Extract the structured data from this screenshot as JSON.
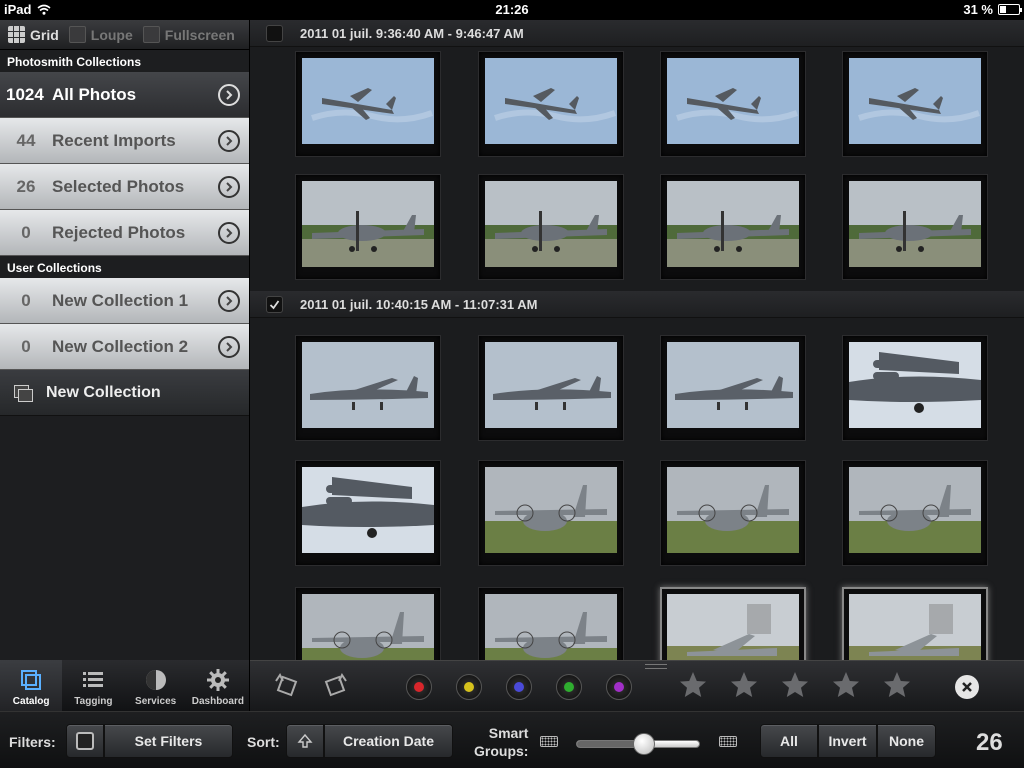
{
  "status": {
    "device": "iPad",
    "time": "21:26",
    "battery": "31 %",
    "battery_level": 0.31
  },
  "view_modes": [
    {
      "label": "Grid",
      "active": true,
      "icon": "grid-icon"
    },
    {
      "label": "Loupe",
      "active": false,
      "icon": "loupe-icon"
    },
    {
      "label": "Fullscreen",
      "active": false,
      "icon": "fullscreen-icon"
    }
  ],
  "photosmith_collections": {
    "header": "Photosmith Collections",
    "items": [
      {
        "count": "1024",
        "label": "All Photos"
      },
      {
        "count": "44",
        "label": "Recent Imports"
      },
      {
        "count": "26",
        "label": "Selected Photos"
      },
      {
        "count": "0",
        "label": "Rejected Photos"
      }
    ]
  },
  "user_collections": {
    "header": "User Collections",
    "items": [
      {
        "count": "0",
        "label": "New Collection 1"
      },
      {
        "count": "0",
        "label": "New Collection 2"
      }
    ],
    "new_label": "New Collection"
  },
  "groups": [
    {
      "title": "2011 01 juil. 9:36:40 AM - 9:46:47 AM",
      "checked": false
    },
    {
      "title": "2011 01 juil. 10:40:15 AM - 11:07:31 AM",
      "checked": true
    }
  ],
  "tabs": [
    {
      "label": "Catalog",
      "icon": "catalog-icon",
      "active": true
    },
    {
      "label": "Tagging",
      "icon": "tagging-list-icon",
      "active": false
    },
    {
      "label": "Services",
      "icon": "services-icon",
      "active": false
    },
    {
      "label": "Dashboard",
      "icon": "gear-icon",
      "active": false
    }
  ],
  "color_labels": [
    "#d8262b",
    "#d6c21c",
    "#4a4ad8",
    "#2fae2f",
    "#a22fc8"
  ],
  "rating_stars": 5,
  "filters": {
    "filters_label": "Filters:",
    "set_filters": "Set Filters",
    "sort_label": "Sort:",
    "sort_value": "Creation Date",
    "smart_groups_line1": "Smart",
    "smart_groups_line2": "Groups:",
    "smart_groups_level": 0.55,
    "select_all": "All",
    "select_invert": "Invert",
    "select_none": "None",
    "selected_count": "26"
  }
}
